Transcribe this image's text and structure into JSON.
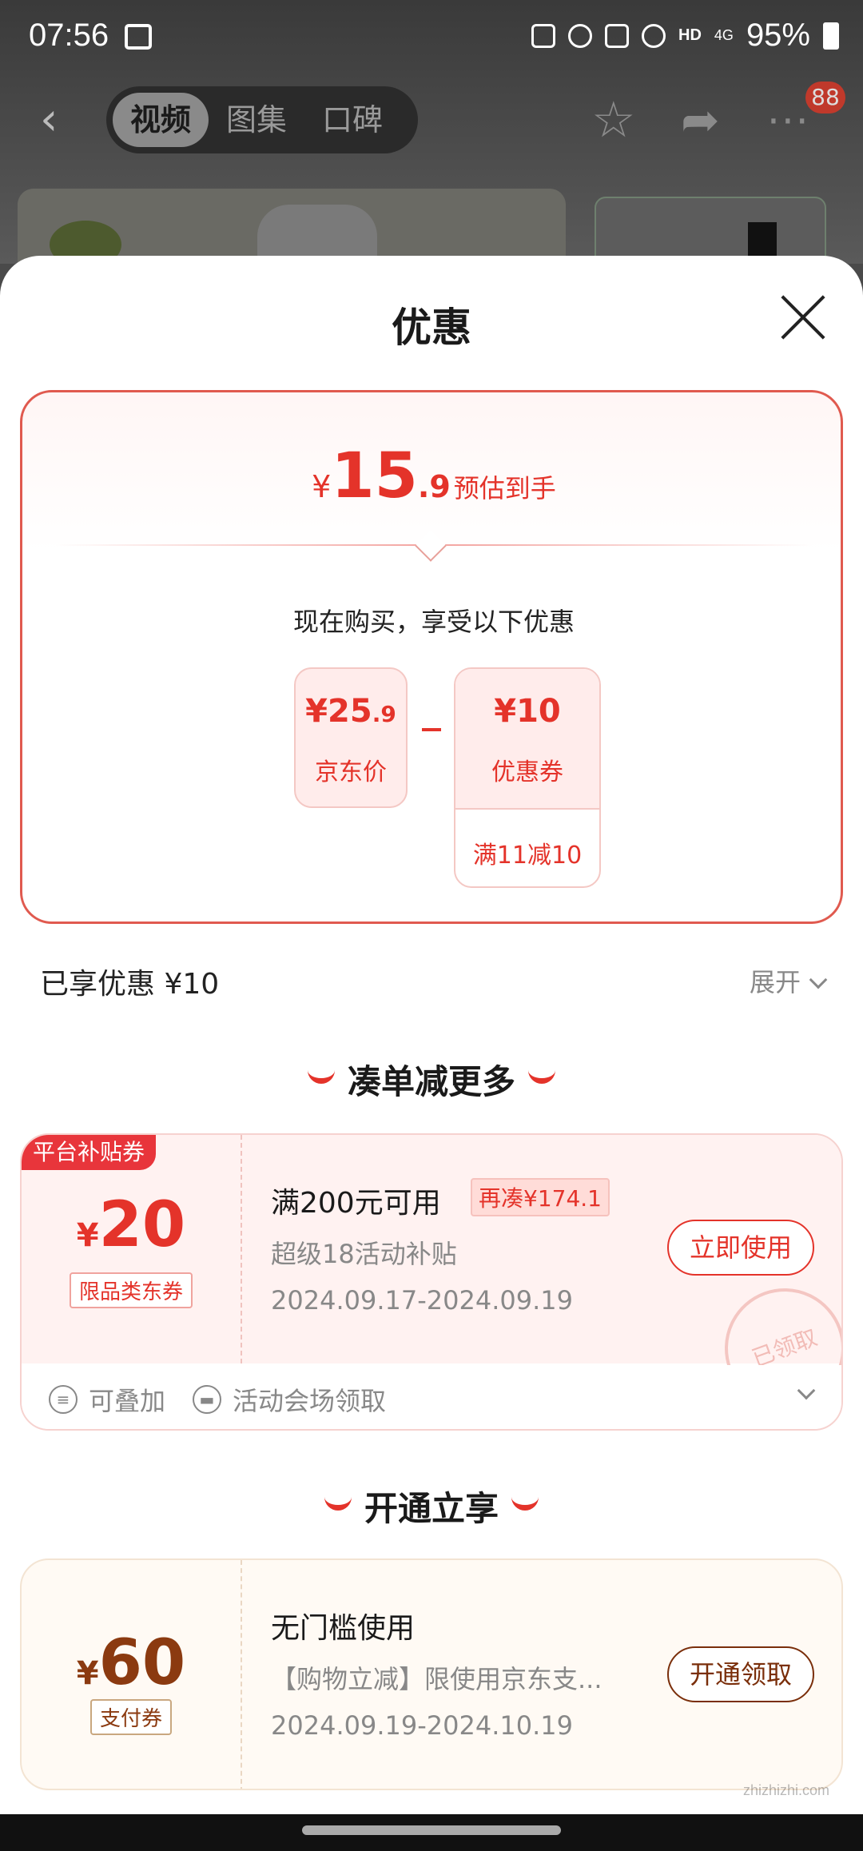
{
  "status_bar": {
    "time": "07:56",
    "network": "HD",
    "signal_label": "4G",
    "battery": "95%"
  },
  "nav": {
    "tabs": [
      {
        "label": "视频",
        "active": true
      },
      {
        "label": "图集",
        "active": false
      },
      {
        "label": "口碑",
        "active": false
      }
    ],
    "badge": "88"
  },
  "sheet": {
    "title": "优惠",
    "estimate": {
      "yen": "¥",
      "integer": "15",
      "decimal": ".9",
      "label": "预估到手"
    },
    "buy_now": "现在购买，享受以下优惠",
    "calc": {
      "price": {
        "yen": "¥",
        "integer": "25",
        "decimal": ".9",
        "label": "京东价"
      },
      "coupon": {
        "amount": "¥10",
        "label": "优惠券",
        "condition": "满11减10"
      }
    },
    "enjoyed": "已享优惠 ¥10",
    "expand": "展开"
  },
  "section1": {
    "title": "凑单减更多",
    "coupon": {
      "corner_tag": "平台补贴券",
      "yen": "¥",
      "amount": "20",
      "tag": "限品类东券",
      "title": "满200元可用",
      "need_more": "再凑¥174.1",
      "desc": "超级18活动补贴",
      "date": "2024.09.17-2024.09.19",
      "button": "立即使用",
      "stamp": "已领取",
      "foot_stackable": "可叠加",
      "foot_source": "活动会场领取"
    }
  },
  "section2": {
    "title": "开通立享",
    "coupon": {
      "yen": "¥",
      "amount": "60",
      "tag": "支付券",
      "title": "无门槛使用",
      "desc": "【购物立减】限使用京东支...",
      "date": "2024.09.19-2024.10.19",
      "button": "开通领取"
    }
  },
  "watermark": "zhizhizhi.com",
  "colors": {
    "accent": "#e4332a",
    "gold": "#8b3a10",
    "card_bg": "#fff2f1"
  }
}
